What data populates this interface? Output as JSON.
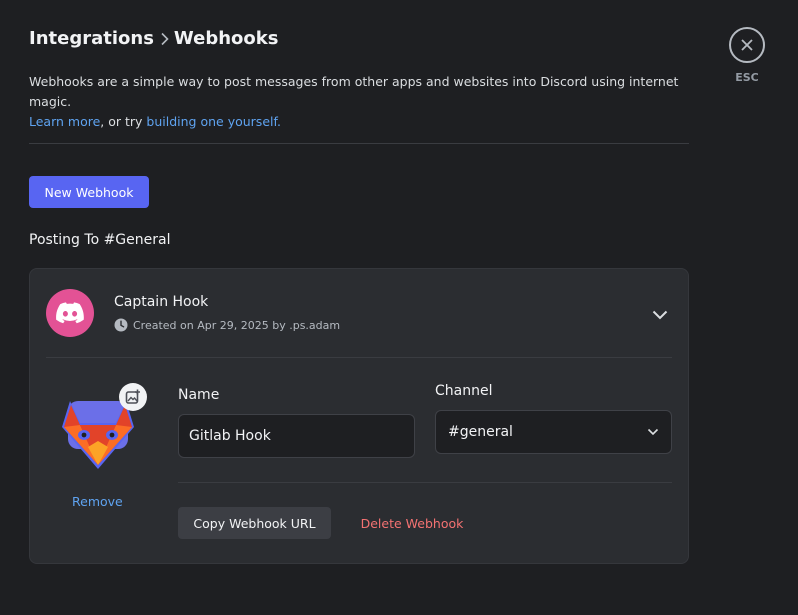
{
  "header": {
    "breadcrumb_parent": "Integrations",
    "breadcrumb_current": "Webhooks"
  },
  "description": {
    "text": "Webhooks are a simple way to post messages from other apps and websites into Discord using internet magic.",
    "learn_more": "Learn more",
    "middle": ", or try ",
    "build_link": "building one yourself."
  },
  "actions": {
    "new_webhook": "New Webhook"
  },
  "posting_to": "Posting To #General",
  "webhook": {
    "name": "Captain Hook",
    "created": "Created on Apr 29, 2025 by .ps.adam",
    "form": {
      "name_label": "Name",
      "name_value": "Gitlab Hook",
      "channel_label": "Channel",
      "channel_value": "#general",
      "remove": "Remove",
      "copy_url": "Copy Webhook URL",
      "delete": "Delete Webhook"
    }
  },
  "close": {
    "label": "ESC"
  },
  "colors": {
    "background": "#1e1f22",
    "card": "#2b2d31",
    "accent": "#5865f2",
    "link": "#5fa3f0",
    "danger": "#f47272",
    "avatar": "#e35295",
    "gitlab_orange": "#e24329"
  },
  "icons": {
    "breadcrumb_separator": "chevron-right-icon",
    "avatar": "discord-logo-icon",
    "created": "clock-icon",
    "expand": "chevron-down-icon",
    "webhook_avatar": "gitlab-logo-icon",
    "upload": "image-upload-icon",
    "channel_dropdown": "chevron-down-icon",
    "close": "close-icon"
  }
}
